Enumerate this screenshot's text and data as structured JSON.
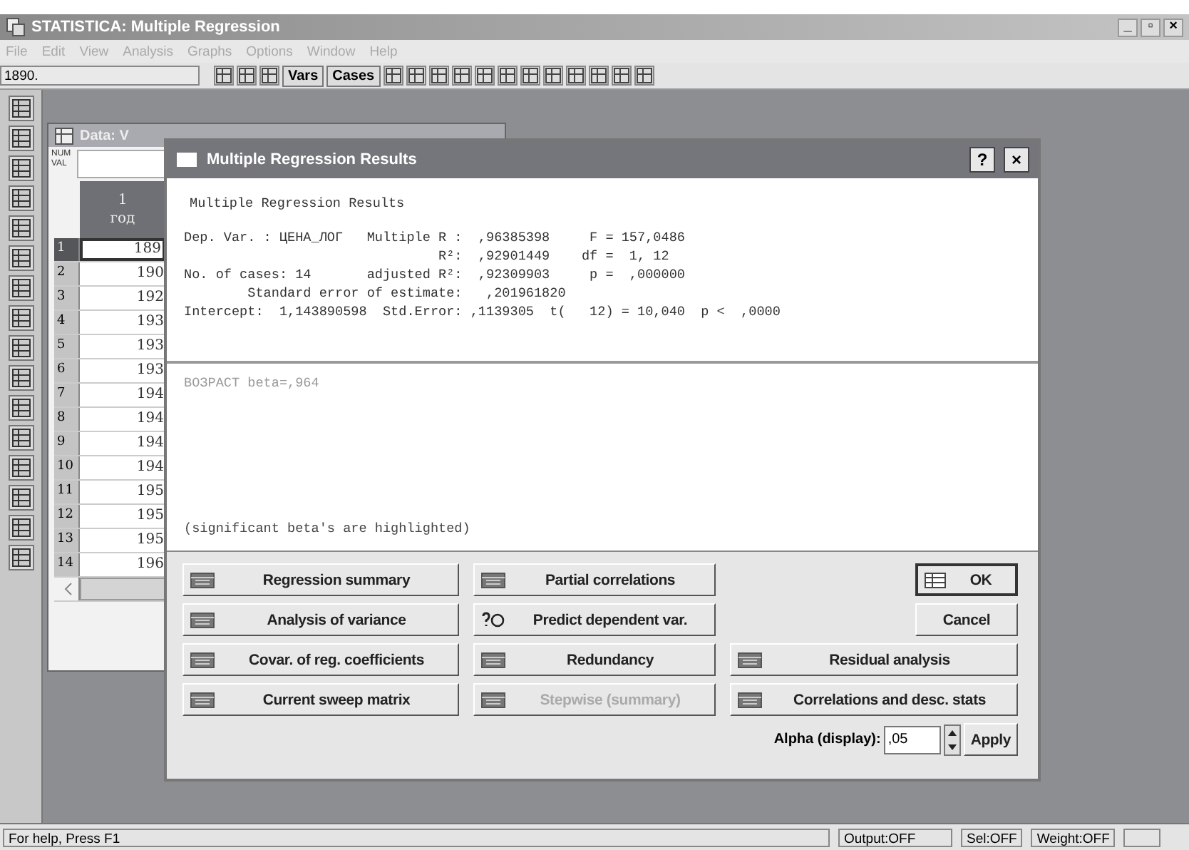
{
  "window": {
    "title": "STATISTICA: Multiple Regression",
    "controls": [
      "_",
      "▫",
      "×"
    ]
  },
  "menu": [
    {
      "label": "File",
      "disabled": true
    },
    {
      "label": "Edit",
      "disabled": true
    },
    {
      "label": "View",
      "disabled": true
    },
    {
      "label": "Analysis",
      "disabled": true
    },
    {
      "label": "Graphs",
      "disabled": true
    },
    {
      "label": "Options",
      "disabled": true
    },
    {
      "label": "Window",
      "disabled": true
    },
    {
      "label": "Help",
      "disabled": true
    }
  ],
  "toolbar": {
    "cell_value": "1890.",
    "buttons": [
      "Vars",
      "Cases"
    ]
  },
  "data_window": {
    "title": "Data: V",
    "corner_label": "NUM VAL",
    "column_number": "1",
    "column_name": "год",
    "rows": [
      {
        "number": "1",
        "value": "189",
        "selected": true
      },
      {
        "number": "2",
        "value": "190",
        "selected": false
      },
      {
        "number": "3",
        "value": "192",
        "selected": false
      },
      {
        "number": "4",
        "value": "193",
        "selected": false
      },
      {
        "number": "5",
        "value": "193",
        "selected": false
      },
      {
        "number": "6",
        "value": "193",
        "selected": false
      },
      {
        "number": "7",
        "value": "194",
        "selected": false
      },
      {
        "number": "8",
        "value": "194",
        "selected": false
      },
      {
        "number": "9",
        "value": "194",
        "selected": false
      },
      {
        "number": "10",
        "value": "194",
        "selected": false
      },
      {
        "number": "11",
        "value": "195",
        "selected": false
      },
      {
        "number": "12",
        "value": "195",
        "selected": false
      },
      {
        "number": "13",
        "value": "195",
        "selected": false
      },
      {
        "number": "14",
        "value": "196",
        "selected": false
      }
    ]
  },
  "dialog": {
    "title": "Multiple Regression Results",
    "title_buttons": [
      "?",
      "×"
    ],
    "heading": "Multiple Regression Results",
    "lines": [
      "Dep. Var. : ЦЕНА_ЛОГ   Multiple R :  ,96385398     F = 157,0486",
      "                                R²:  ,92901449    df =  1, 12",
      "No. of cases: 14       adjusted R²:  ,92309903     p =  ,000000",
      "        Standard error of estimate:   ,201961820",
      "Intercept:  1,143890598  Std.Error: ,1139305  t(   12) = 10,040  p <  ,0000"
    ],
    "beta": "ВОЗРАСТ beta=,964",
    "note": "(significant beta's are highlighted)",
    "buttons": [
      {
        "label": "Regression summary",
        "kind": "table",
        "disabled": false
      },
      {
        "label": "Partial correlations",
        "kind": "table",
        "disabled": false
      },
      {
        "label": "OK",
        "kind": "ok",
        "disabled": false
      },
      {
        "label": "Analysis of variance",
        "kind": "table",
        "disabled": false
      },
      {
        "label": "Predict dependent var.",
        "kind": "predict",
        "disabled": false
      },
      {
        "label": "Cancel",
        "kind": "plain",
        "disabled": false
      },
      {
        "label": "Covar. of reg. coefficients",
        "kind": "table",
        "disabled": false
      },
      {
        "label": "Redundancy",
        "kind": "table",
        "disabled": false
      },
      {
        "label": "Residual analysis",
        "kind": "table",
        "disabled": false
      },
      {
        "label": "Current sweep matrix",
        "kind": "table",
        "disabled": false
      },
      {
        "label": "Stepwise (summary)",
        "kind": "table",
        "disabled": true
      },
      {
        "label": "Correlations and desc. stats",
        "kind": "table",
        "disabled": false
      }
    ],
    "alpha": {
      "label": "Alpha (display):",
      "value": ",05",
      "apply": "Apply"
    }
  },
  "status_bar": [
    "For help, Press F1",
    "Output:OFF",
    "Sel:OFF",
    "Weight:OFF"
  ]
}
